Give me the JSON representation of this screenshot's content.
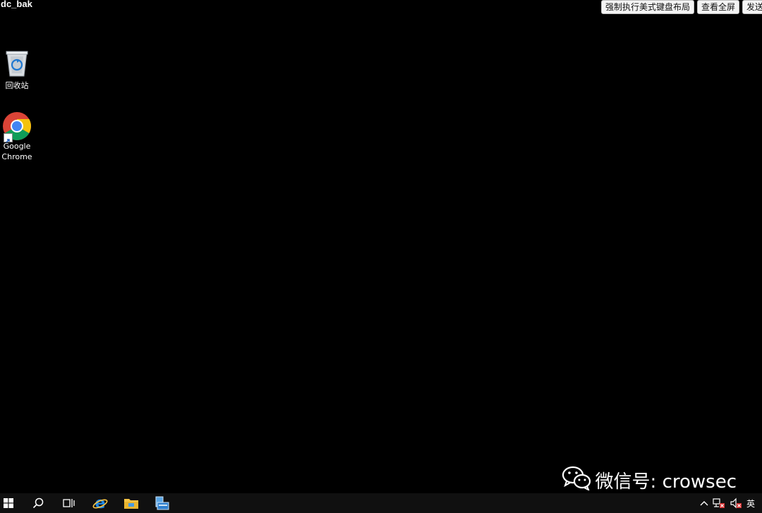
{
  "session": {
    "title": "dc_bak"
  },
  "toolbar": {
    "force_us_keyboard": "强制执行美式键盘布局",
    "view_fullscreen": "查看全屏",
    "send": "发送"
  },
  "desktop": {
    "icons": [
      {
        "label_lines": [
          "回收站"
        ],
        "icon": "recycle-bin-icon"
      },
      {
        "label_lines": [
          "Google",
          "Chrome"
        ],
        "icon": "chrome-icon"
      }
    ]
  },
  "watermark": {
    "text": "微信号: crowsec",
    "icon": "wechat-icon"
  },
  "taskbar": {
    "items": [
      "windows-start-icon",
      "search-icon",
      "task-view-icon",
      "internet-explorer-icon",
      "file-explorer-icon",
      "server-manager-icon"
    ],
    "tray": {
      "icons": [
        "chevron-up-icon",
        "network-disconnected-icon",
        "volume-muted-icon"
      ],
      "ime": "英"
    }
  },
  "colors": {
    "desktop_bg": "#000000",
    "taskbar_bg": "#101010",
    "chrome_red": "#db4437",
    "chrome_yellow": "#f4c20d",
    "chrome_green": "#0f9d58",
    "chrome_blue": "#4285f4",
    "ie_blue": "#1e88e5",
    "folder_yellow": "#f6c445"
  }
}
